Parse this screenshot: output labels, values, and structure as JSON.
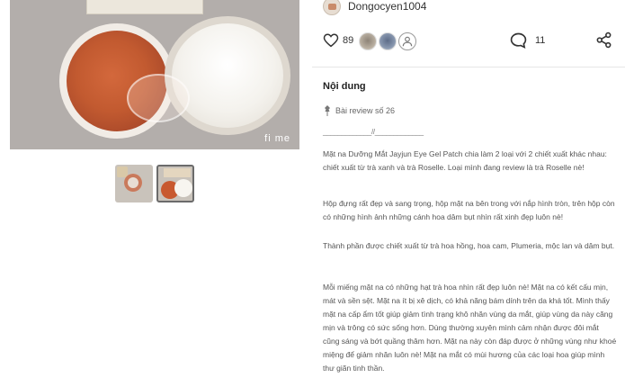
{
  "gallery": {
    "watermark": "fi me",
    "thumbnails": [
      "thumbnail-1",
      "thumbnail-2"
    ]
  },
  "post": {
    "username": "Dongocyen1004",
    "like_count": "89",
    "comment_count": "11"
  },
  "content": {
    "section_title": "Nội dung",
    "tag_label": "Bài review số 26",
    "separator": "_____________//_____________",
    "paragraphs": [
      "Mặt na Dưỡng Mắt Jayjun Eye Gel Patch chia làm 2 loại với 2 chiết xuất khác nhau: chiết xuất từ trà xanh và trà Roselle. Loại mình đang review là trà Roselle nè!",
      "Hộp đựng rất đẹp và sang trọng, hộp mặt na bên trong với nắp hình tròn, trên hộp còn có những hình ảnh những cánh hoa dâm bụt nhìn rất xinh đẹp luôn nè!",
      "Thành phần được chiết xuất từ trà hoa hồng, hoa cam, Plumeria, mộc lan và dâm bụt.",
      "Mỗi miếng mặt na có những hạt trà hoa nhìn rất đẹp luôn nè! Mặt na có kết cấu mịn, mát và sền sệt. Mặt na ít bị xê dịch, có khả năng bám dính trên da khá tốt. Mình thấy mặt na cấp ẩm tốt giúp giảm tình trạng khô nhăn vùng da mắt, giúp vùng da này căng mịn và trông có sức sống hơn. Dùng thường xuyên mình cảm nhận được đôi mắt cũng sáng và bớt quầng thâm hơn. Mặt na này còn đáp được ở những vùng như khoé miệng để giảm nhăn luôn nè! Mặt na mắt có mùi hương của các loại hoa giúp mình thư giãn tinh thần."
    ]
  },
  "colors": {
    "accent": "#c25a30",
    "text": "#333333",
    "muted": "#666666"
  }
}
